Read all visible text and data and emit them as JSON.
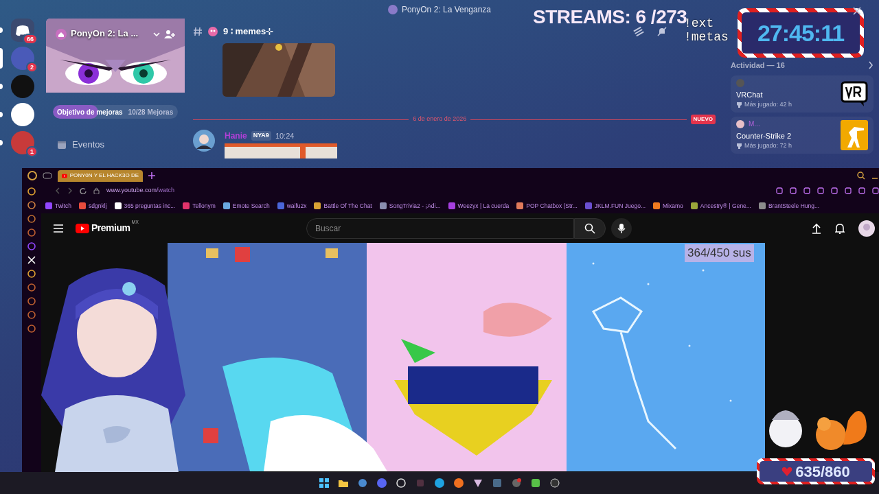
{
  "discord": {
    "title": "PonyOn 2: La Venganza",
    "servers": [
      {
        "kind": "home",
        "badge": "66",
        "selected": false
      },
      {
        "kind": "server",
        "badge": "2",
        "selected": true
      },
      {
        "kind": "server",
        "selected": false
      },
      {
        "kind": "server",
        "selected": false
      },
      {
        "kind": "server",
        "badge": "1",
        "selected": false
      }
    ],
    "server_name": "PonyOn 2: La ...",
    "boost": {
      "label": "Objetivo de mejoras",
      "count": "10/28 Mejoras",
      "level": 0.36
    },
    "channels": [
      {
        "label": "Eventos"
      }
    ],
    "channel_name": "9 ∶ memes⊹",
    "date_divider": "6 de enero de 2026",
    "new_badge": "NUEVO",
    "message": {
      "author": "Hanie",
      "tag": "NYA9",
      "time": "10:24"
    },
    "activity": {
      "header": "Actividad — 16",
      "cards": [
        {
          "game": "VRChat",
          "played": "Más jugado: 42 h"
        },
        {
          "user": "M...",
          "game": "Counter-Strike 2",
          "played": "Más jugado: 72 h"
        }
      ]
    }
  },
  "browser": {
    "tab": "PONY0N Y EL HACK3O DE",
    "url_host": "www.youtube.com",
    "url_path": "/watch",
    "bookmarks": [
      {
        "label": "Twitch",
        "color": "#9146ff"
      },
      {
        "label": "sdgnklj",
        "color": "#e84c3d"
      },
      {
        "label": "365 preguntas inc...",
        "color": "#ffffff"
      },
      {
        "label": "Tellonym",
        "color": "#e2336b"
      },
      {
        "label": "Emote Search",
        "color": "#6aa9e0"
      },
      {
        "label": "waifu2x",
        "color": "#4a66d8"
      },
      {
        "label": "Battle Of The Chat",
        "color": "#d9a334"
      },
      {
        "label": "SongTrivia2 - ¡Adi...",
        "color": "#8a8fb0"
      },
      {
        "label": "Weezyx | La cuerda",
        "color": "#a63fe0"
      },
      {
        "label": "POP Chatbox (Str...",
        "color": "#e07a5a"
      },
      {
        "label": "JKLM.FUN Juego...",
        "color": "#6a4fd0"
      },
      {
        "label": "Mixamo",
        "color": "#f07a20"
      },
      {
        "label": "Ancestry® | Gene...",
        "color": "#9aa53a"
      },
      {
        "label": "BrantSteele Hung...",
        "color": "#8c8c8c"
      }
    ],
    "youtube": {
      "logo": "Premium",
      "region": "MX",
      "search_placeholder": "Buscar"
    }
  },
  "overlay": {
    "streams": "STREAMS: 6 /273",
    "commands": [
      "!ext",
      "!metas"
    ],
    "timer": "27:45:11",
    "subs": "364/450 sus",
    "hearts": "635/860"
  }
}
